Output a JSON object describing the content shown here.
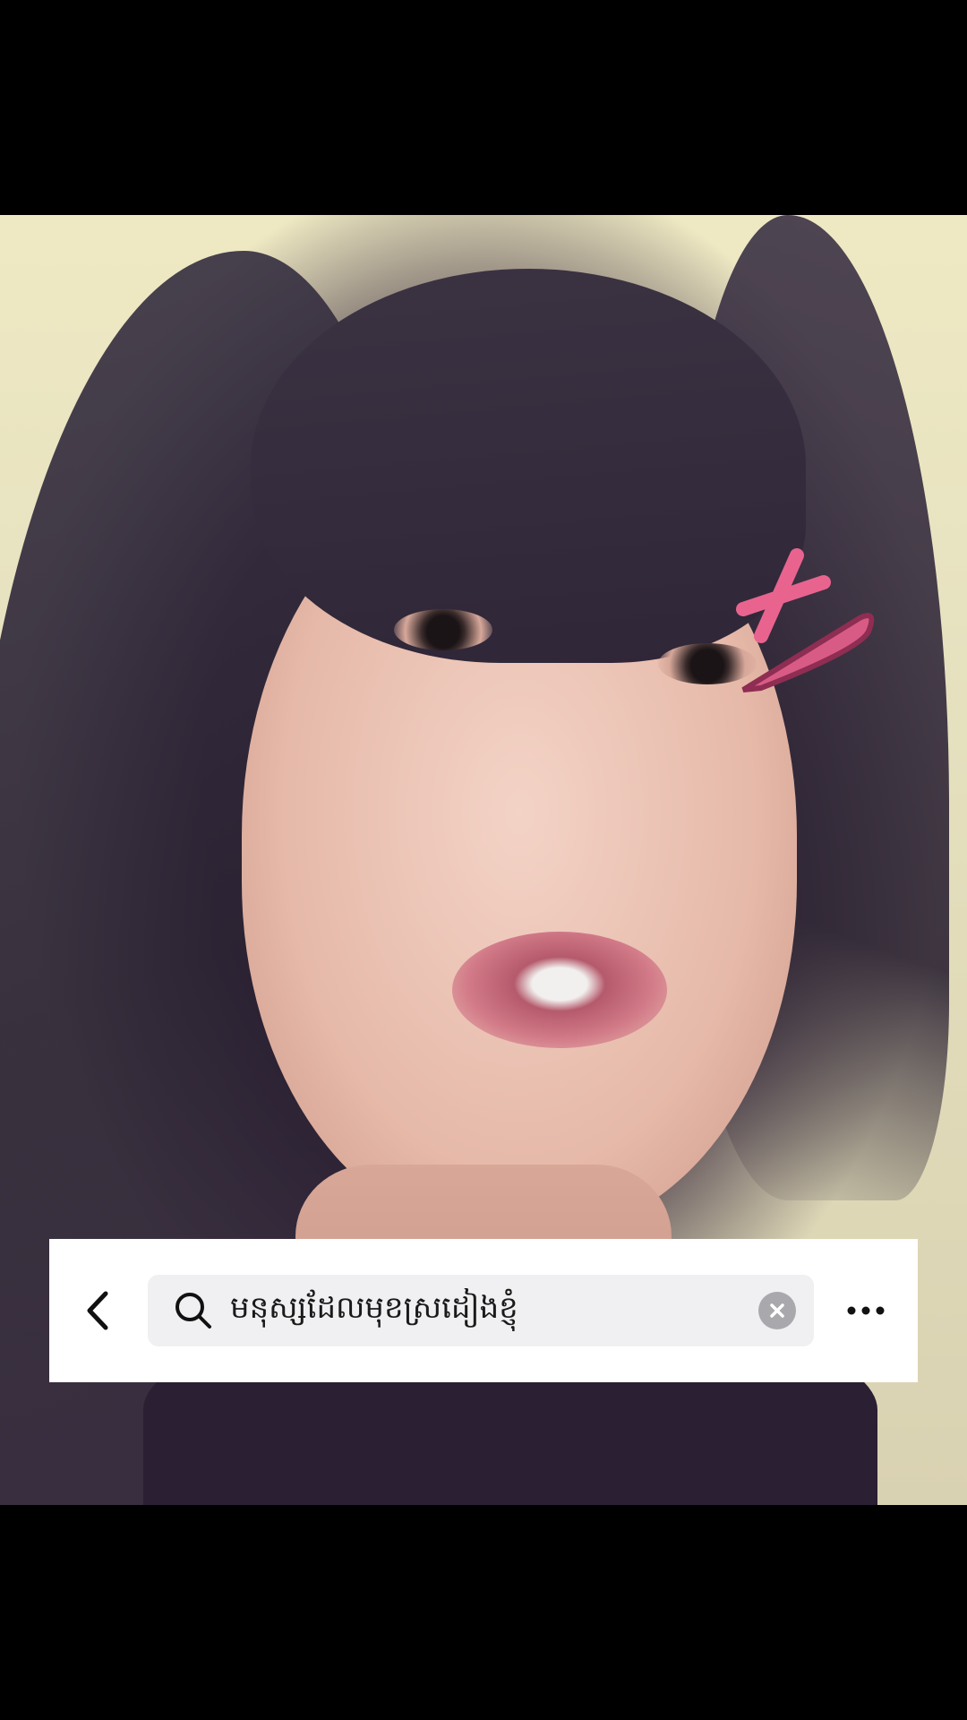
{
  "screen": {
    "background": "#000000"
  },
  "photo": {
    "description_icon": "selfie-photo",
    "sticker_icon": "pink-hair-clip-sticker"
  },
  "search_bar": {
    "back_icon": "chevron-left-icon",
    "search_icon": "magnifier-icon",
    "query": "មនុស្សដែលមុខស្រដៀងខ្ញុំ",
    "clear_icon": "clear-x-icon",
    "more_icon": "more-horizontal-icon",
    "field_color": "#f0f0f2",
    "panel_color": "#ffffff"
  }
}
